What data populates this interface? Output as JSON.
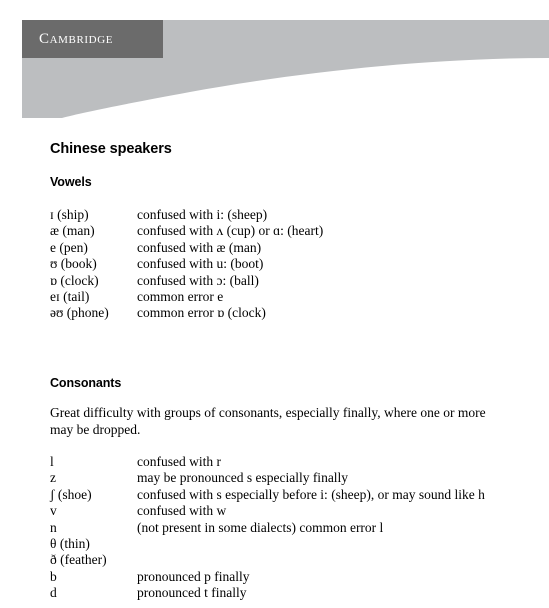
{
  "header": {
    "logo_label": "Cambridge",
    "band_color": "#bcbec0",
    "logo_block_color": "#6b6b6b",
    "logo_text_color": "#ffffff"
  },
  "document": {
    "title": "Chinese speakers",
    "sections": [
      {
        "heading": "Vowels",
        "rows": [
          {
            "symbol": "ɪ (ship)",
            "note": "confused with i: (sheep)"
          },
          {
            "symbol": "æ (man)",
            "note": "confused with ʌ (cup) or ɑ: (heart)"
          },
          {
            "symbol": "e (pen)",
            "note": "confused with æ (man)"
          },
          {
            "symbol": "ʊ (book)",
            "note": "confused with u: (boot)"
          },
          {
            "symbol": "ɒ (clock)",
            "note": "confused with ɔ: (ball)"
          },
          {
            "symbol": "eɪ (tail)",
            "note": "common error e"
          },
          {
            "symbol": "əʊ (phone)",
            "note": "common error ɒ (clock)"
          }
        ]
      },
      {
        "heading": "Consonants",
        "intro": "Great difficulty with groups of consonants, especially finally, where one or more may be dropped.",
        "rows": [
          {
            "symbol": "l",
            "note": "confused with r"
          },
          {
            "symbol": "z",
            "note": "may be pronounced s especially finally"
          },
          {
            "symbol": "ʃ (shoe)",
            "note": "confused with s especially before i: (sheep), or may sound like h"
          },
          {
            "symbol": "v",
            "note": "confused with w"
          },
          {
            "symbol": "n",
            "note": "(not present in some dialects) common error l"
          },
          {
            "symbol": "θ (thin)",
            "note": ""
          },
          {
            "symbol": "ð (feather)",
            "note": ""
          },
          {
            "symbol": "b",
            "note": "pronounced p finally"
          },
          {
            "symbol": "d",
            "note": "pronounced t finally"
          }
        ]
      }
    ]
  }
}
